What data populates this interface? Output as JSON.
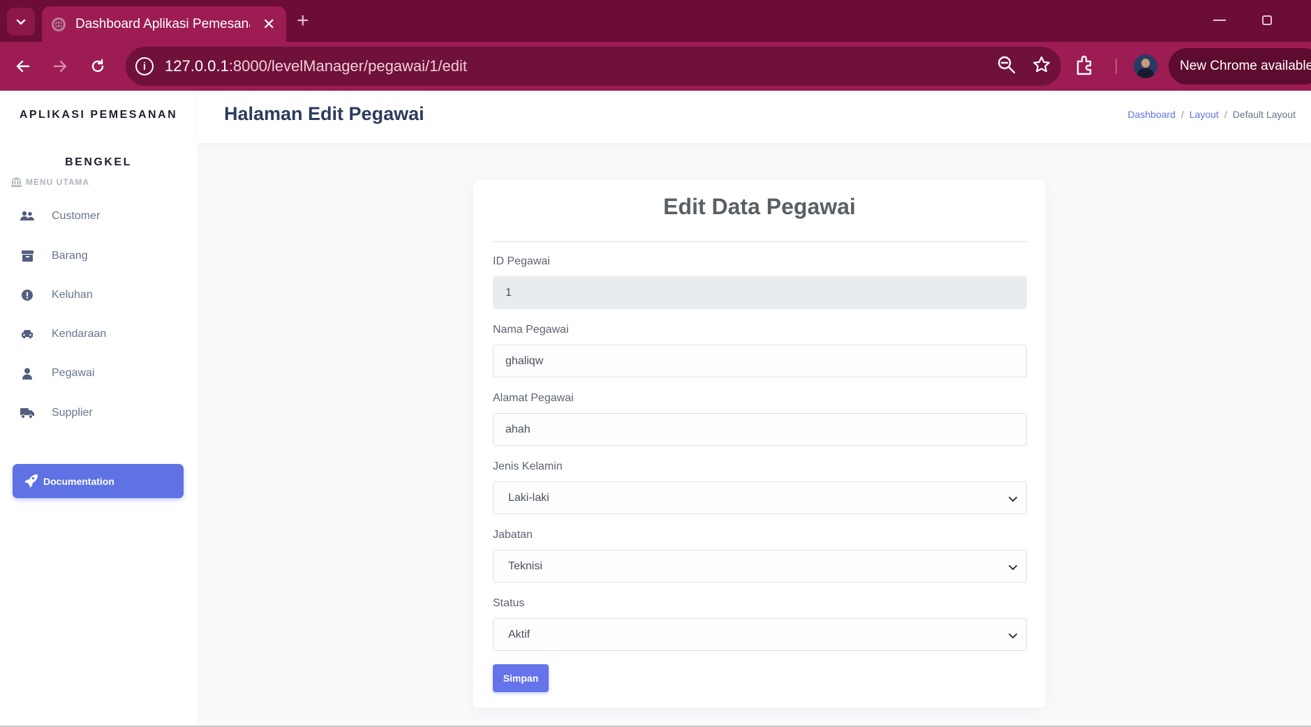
{
  "browser": {
    "tab_title": "Dashboard Aplikasi Pemesanan",
    "url_host": "127.0.0.1",
    "url_rest": ":8000/levelManager/pegawai/1/edit",
    "new_chrome_label": "New Chrome available"
  },
  "sidebar": {
    "brand_line1": "APLIKASI PEMESANAN",
    "brand_line2": "BENGKEL",
    "menu_heading": "MENU UTAMA",
    "items": [
      {
        "label": "Customer",
        "icon": "users-icon"
      },
      {
        "label": "Barang",
        "icon": "box-icon"
      },
      {
        "label": "Keluhan",
        "icon": "alert-icon"
      },
      {
        "label": "Kendaraan",
        "icon": "car-icon"
      },
      {
        "label": "Pegawai",
        "icon": "user-icon"
      },
      {
        "label": "Supplier",
        "icon": "truck-icon"
      }
    ],
    "documentation_label": "Documentation"
  },
  "header": {
    "title": "Halaman Edit Pegawai",
    "breadcrumb": [
      "Dashboard",
      "Layout",
      "Default Layout"
    ]
  },
  "form": {
    "title": "Edit Data Pegawai",
    "fields": {
      "id": {
        "label": "ID Pegawai",
        "value": "1"
      },
      "nama": {
        "label": "Nama Pegawai",
        "value": "ghaliqw"
      },
      "alamat": {
        "label": "Alamat Pegawai",
        "value": "ahah"
      },
      "jenis_kelamin": {
        "label": "Jenis Kelamin",
        "value": "Laki-laki"
      },
      "jabatan": {
        "label": "Jabatan",
        "value": "Teknisi"
      },
      "status": {
        "label": "Status",
        "value": "Aktif"
      }
    },
    "submit_label": "Simpan"
  },
  "colors": {
    "titlebar": "#6b0d36",
    "toolbar": "#9c1c53",
    "accent": "#5e72e4"
  }
}
